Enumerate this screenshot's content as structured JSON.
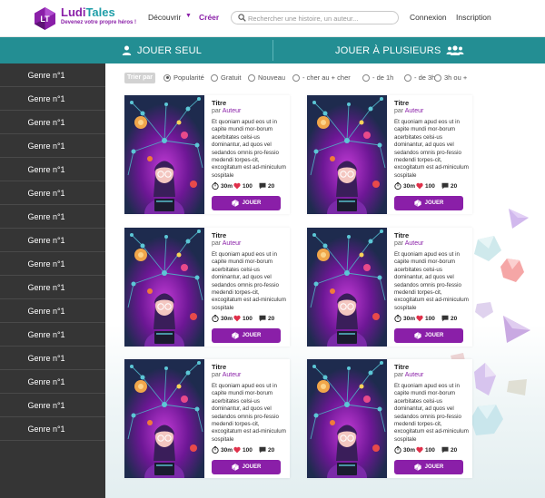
{
  "header": {
    "brand_part1": "Ludi",
    "brand_part2": "Tales",
    "tagline": "Devenez votre propre héros !",
    "nav_discover": "Découvrir",
    "nav_create": "Créer",
    "search_placeholder": "Rechercher une histoire, un auteur...",
    "login": "Connexion",
    "signup": "Inscription"
  },
  "modes": {
    "solo": "JOUER SEUL",
    "multi": "JOUER À PLUSIEURS"
  },
  "sidebar": {
    "genres": [
      "Genre n°1",
      "Genre n°1",
      "Genre n°1",
      "Genre n°1",
      "Genre n°1",
      "Genre n°1",
      "Genre n°1",
      "Genre n°1",
      "Genre n°1",
      "Genre n°1",
      "Genre n°1",
      "Genre n°1",
      "Genre n°1",
      "Genre n°1",
      "Genre n°1",
      "Genre n°1"
    ]
  },
  "filters": {
    "label": "Trier par",
    "options": [
      {
        "label": "Popularité",
        "selected": true
      },
      {
        "label": "Gratuit",
        "selected": false
      },
      {
        "label": "Nouveau",
        "selected": false
      },
      {
        "label": "- cher au + cher",
        "selected": false
      },
      {
        "label": "- de 1h",
        "selected": false
      },
      {
        "label": "- de 3h",
        "selected": false
      },
      {
        "label": "3h ou +",
        "selected": false
      }
    ]
  },
  "cards": [
    {
      "title": "Titre",
      "by": "par",
      "author": "Auteur",
      "description": "Et quoniam apud eos ut in capite mundi mor-borum acerbitates celsi-us dominantur, ad quos vel sedandos omnis pro-fessio medendi torpes-cit, excogitatum est ad-miniculum sospitale",
      "duration": "30m",
      "likes": "100",
      "comments": "20",
      "play": "JOUER"
    },
    {
      "title": "Titre",
      "by": "par",
      "author": "Auteur",
      "description": "Et quoniam apud eos ut in capite mundi mor-borum acerbitates celsi-us dominantur, ad quos vel sedandos omnis pro-fessio medendi torpes-cit, excogitatum est ad-miniculum sospitale",
      "duration": "30m",
      "likes": "100",
      "comments": "20",
      "play": "JOUER"
    },
    {
      "title": "Titre",
      "by": "par",
      "author": "Auteur",
      "description": "Et quoniam apud eos ut in capite mundi mor-borum acerbitates celsi-us dominantur, ad quos vel sedandos omnis pro-fessio medendi torpes-cit, excogitatum est ad-miniculum sospitale",
      "duration": "30m",
      "likes": "100",
      "comments": "20",
      "play": "JOUER"
    },
    {
      "title": "Titre",
      "by": "par",
      "author": "Auteur",
      "description": "Et quoniam apud eos ut in capite mundi mor-borum acerbitates celsi-us dominantur, ad quos vel sedandos omnis pro-fessio medendi torpes-cit, excogitatum est ad-miniculum sospitale",
      "duration": "30m",
      "likes": "100",
      "comments": "20",
      "play": "JOUER"
    },
    {
      "title": "Titre",
      "by": "par",
      "author": "Auteur",
      "description": "Et quoniam apud eos ut in capite mundi mor-borum acerbitates celsi-us dominantur, ad quos vel sedandos omnis pro-fessio medendi torpes-cit, excogitatum est ad-miniculum sospitale",
      "duration": "30m",
      "likes": "100",
      "comments": "20",
      "play": "JOUER"
    },
    {
      "title": "Titre",
      "by": "par",
      "author": "Auteur",
      "description": "Et quoniam apud eos ut in capite mundi mor-borum acerbitates celsi-us dominantur, ad quos vel sedandos omnis pro-fessio medendi torpes-cit, excogitatum est ad-miniculum sospitale",
      "duration": "30m",
      "likes": "100",
      "comments": "20",
      "play": "JOUER"
    }
  ],
  "colors": {
    "brand_purple": "#8a1fa8",
    "brand_teal": "#238e93",
    "sidebar_bg": "#353535"
  },
  "icons": {
    "solo": "user-icon",
    "multi": "users-icon",
    "duration": "timer-icon",
    "likes": "heart-icon",
    "comments": "comment-icon",
    "play": "dice-icon"
  }
}
